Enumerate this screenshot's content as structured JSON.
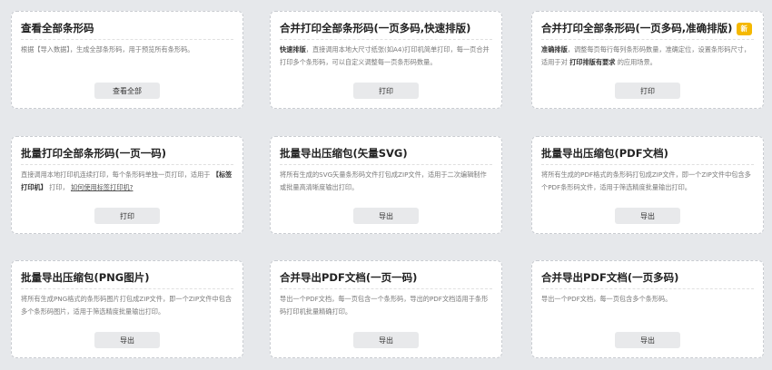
{
  "cards": [
    {
      "title": "查看全部条形码",
      "desc": "根据【导入数据】，生成全部条形码，用于预览所有条形码。",
      "button": "查看全部"
    },
    {
      "title": "合并打印全部条形码(一页多码,快速排版)",
      "desc_bold": "快速排版",
      "desc": "，直接调用本地大尺寸纸张(如A4)打印机简单打印，每一页合并打印多个条形码，可以自定义调整每一页条形码数量。",
      "button": "打印"
    },
    {
      "title": "合并打印全部条形码(一页多码,准确排版)",
      "badge": "新",
      "desc_bold": "准确排版",
      "desc": "，调整每页每行每列条形码数量，准确定位，设置条形码尺寸，适用于对",
      "desc_bold2": "打印排版有要求",
      "desc_tail": "的应用场景。",
      "button": "打印"
    },
    {
      "title": "批量打印全部条形码(一页一码)",
      "desc": "直接调用本地打印机连续打印，每个条形码单独一页打印，适用于",
      "desc_bold": "【标签打印机】",
      "desc_mid": "打印，",
      "desc_link": "如何使用标签打印机?",
      "button": "打印"
    },
    {
      "title": "批量导出压缩包(矢量SVG)",
      "desc": "将所有生成的SVG矢量条形码文件打包成ZIP文件，适用于二次编辑制作或批量高清晰度输出打印。",
      "button": "导出"
    },
    {
      "title": "批量导出压缩包(PDF文档)",
      "desc": "将所有生成的PDF格式的条形码打包成ZIP文件，即一个ZIP文件中包含多个PDF条形码文件，适用于筛选精度批量输出打印。",
      "button": "导出"
    },
    {
      "title": "批量导出压缩包(PNG图片)",
      "desc": "将所有生成PNG格式的条形码图片打包成ZIP文件，即一个ZIP文件中包含多个条形码图片，适用于筛选精度批量输出打印。",
      "button": "导出"
    },
    {
      "title": "合并导出PDF文档(一页一码)",
      "desc": "导出一个PDF文档，每一页包含一个条形码，导出的PDF文档适用于条形码打印机批量精确打印。",
      "button": "导出"
    },
    {
      "title": "合并导出PDF文档(一页多码)",
      "desc": "导出一个PDF文档，每一页包含多个条形码。",
      "button": "导出"
    }
  ]
}
